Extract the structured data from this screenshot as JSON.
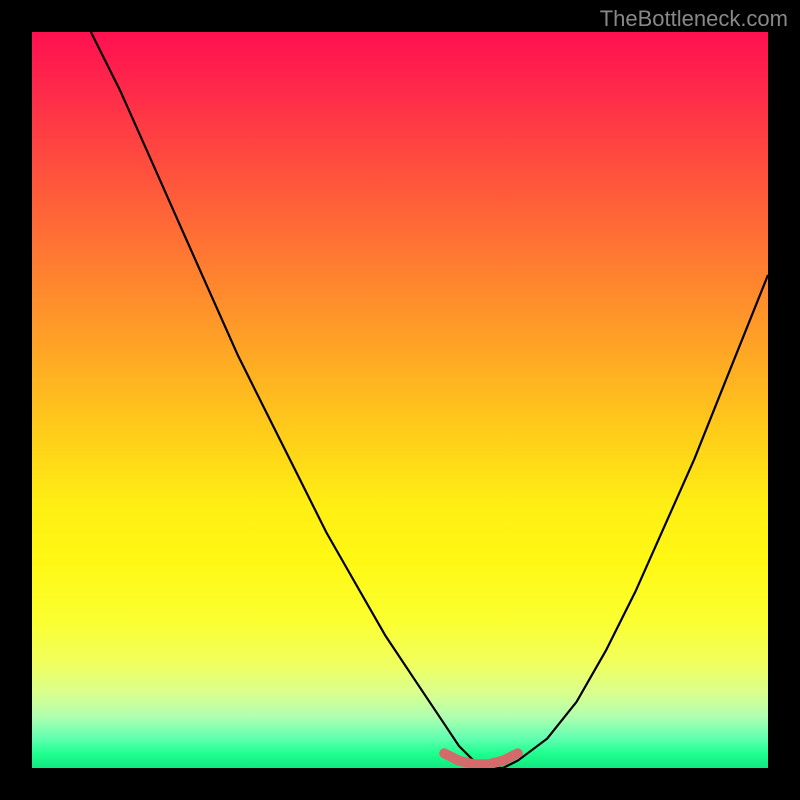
{
  "watermark": "TheBottleneck.com",
  "chart_data": {
    "type": "line",
    "title": "",
    "xlabel": "",
    "ylabel": "",
    "xlim": [
      0,
      100
    ],
    "ylim": [
      0,
      100
    ],
    "grid": false,
    "legend": false,
    "gradient_stops": [
      {
        "pos": 0,
        "color": "#ff1050"
      },
      {
        "pos": 0.5,
        "color": "#ffd218"
      },
      {
        "pos": 0.85,
        "color": "#fbff30"
      },
      {
        "pos": 1.0,
        "color": "#10e880"
      }
    ],
    "series": [
      {
        "name": "curve",
        "color": "#000000",
        "x": [
          8,
          12,
          16,
          20,
          24,
          28,
          32,
          36,
          40,
          44,
          48,
          52,
          56,
          58,
          60,
          62,
          64,
          66,
          70,
          74,
          78,
          82,
          86,
          90,
          94,
          98,
          100
        ],
        "y": [
          100,
          92,
          83,
          74,
          65,
          56,
          48,
          40,
          32,
          25,
          18,
          12,
          6,
          3,
          1,
          0,
          0,
          1,
          4,
          9,
          16,
          24,
          33,
          42,
          52,
          62,
          67
        ]
      },
      {
        "name": "marker-band",
        "color": "#d46a6a",
        "x": [
          56,
          58,
          60,
          62,
          64,
          66
        ],
        "y": [
          2,
          1,
          0.5,
          0.5,
          1,
          2
        ]
      }
    ],
    "annotations": []
  }
}
